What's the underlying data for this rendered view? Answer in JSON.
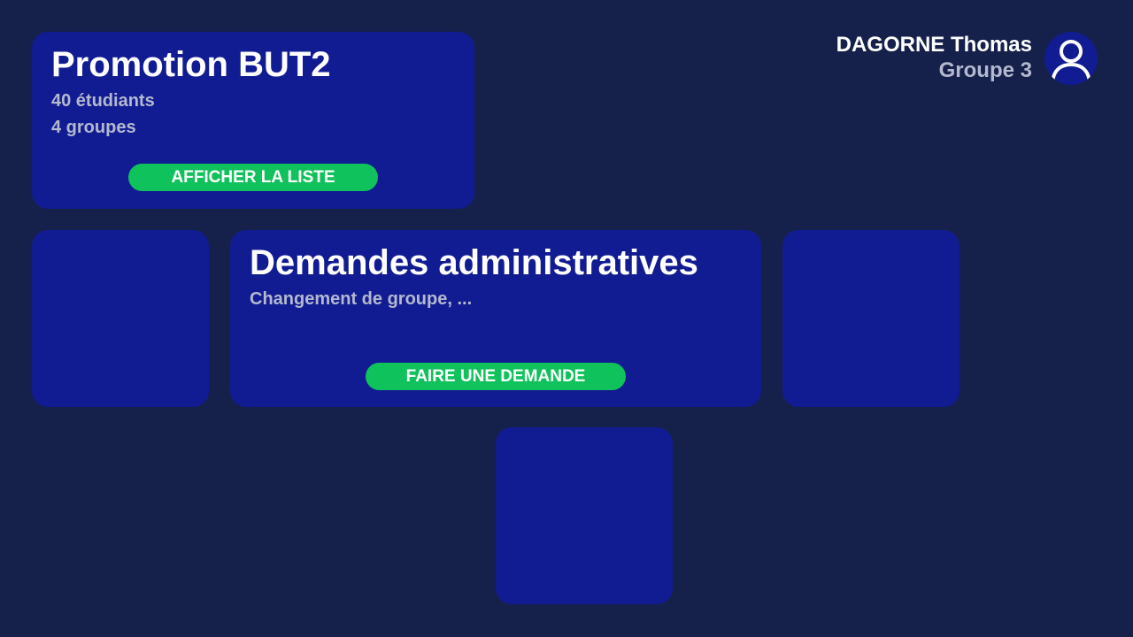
{
  "user": {
    "name": "DAGORNE Thomas",
    "group": "Groupe 3",
    "avatar_icon": "user-icon"
  },
  "promotion_card": {
    "title": "Promotion BUT2",
    "students": "40 étudiants",
    "groups": "4 groupes",
    "button_label": "AFFICHER LA LISTE"
  },
  "requests_card": {
    "title": "Demandes administratives",
    "subtitle": "Changement de groupe, ...",
    "button_label": "FAIRE UNE DEMANDE"
  },
  "colors": {
    "background": "#15204b",
    "card": "#121c92",
    "accent_button": "#10c25b",
    "primary_text": "#ffffff",
    "secondary_text": "#b4b9cf"
  }
}
